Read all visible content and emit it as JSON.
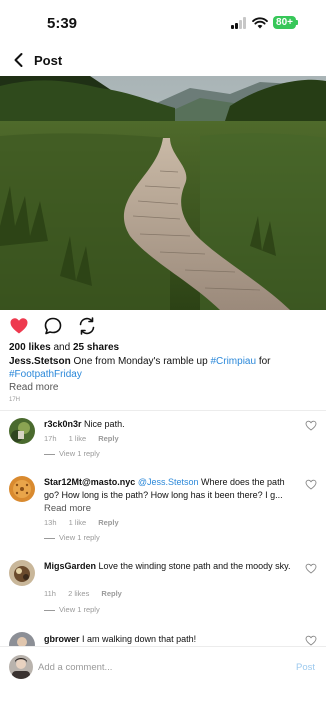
{
  "status_bar": {
    "time": "5:39",
    "battery_percent": "80+"
  },
  "nav": {
    "title": "Post"
  },
  "post": {
    "likes": "200 likes",
    "and": "and",
    "shares": "25 shares",
    "author": "Jess.Stetson",
    "caption_text": "One from Monday's ramble up",
    "hashtag_1": "#Crimpiau",
    "caption_for": "for",
    "hashtag_2": "#FootpathFriday",
    "read_more": "Read more",
    "age": "17H",
    "liked": true
  },
  "comments": [
    {
      "user": "r3ck0n3r",
      "text": "Nice path.",
      "time": "17h",
      "likes": "1 like",
      "reply": "Reply",
      "view_replies": "View 1 reply"
    },
    {
      "user": "Star12Mt@masto.nyc",
      "mention": "@Jess.Stetson",
      "text": "Where does the path go? How long is the path? How long has it been there? I g...",
      "read_more": "Read more",
      "time": "13h",
      "likes": "1 like",
      "reply": "Reply",
      "view_replies": "View 1 reply"
    },
    {
      "user": "MigsGarden",
      "text": "Love the winding stone path and the moody sky.",
      "time": "11h",
      "likes": "2 likes",
      "reply": "Reply",
      "view_replies": "View 1 reply"
    },
    {
      "user": "gbrower",
      "text": "I am walking down that path!"
    }
  ],
  "composer": {
    "placeholder": "Add a comment...",
    "post_label": "Post"
  },
  "colors": {
    "like_red": "#ee3a4f",
    "link_blue": "#2b88d9",
    "post_disabled": "#9cc9ee",
    "battery_green": "#37c759"
  }
}
